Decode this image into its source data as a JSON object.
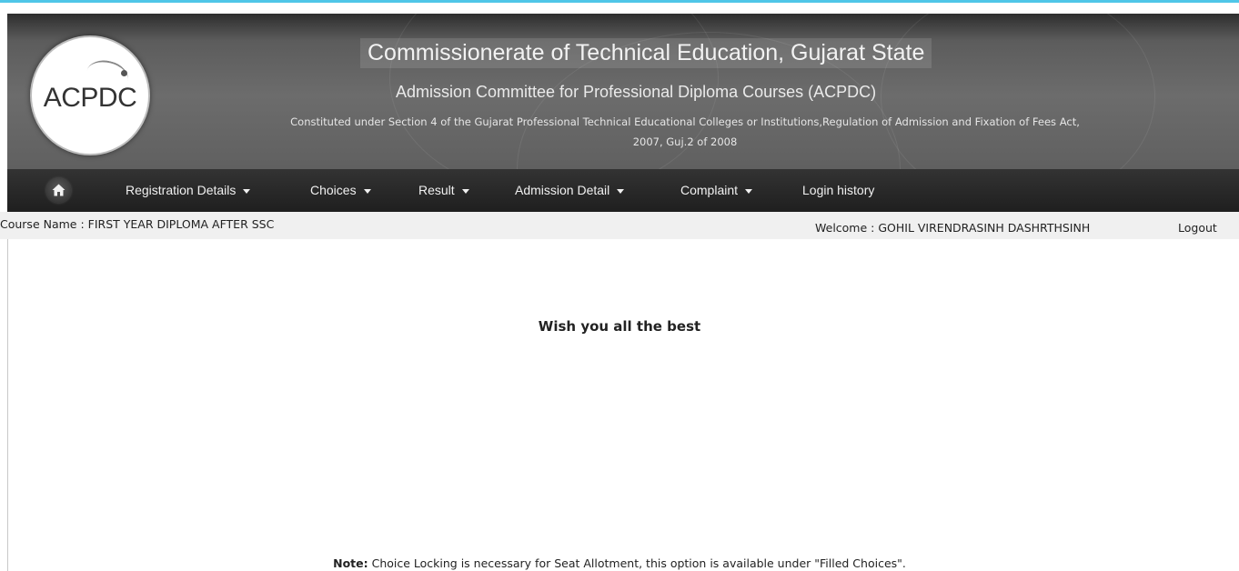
{
  "header": {
    "logo_text": "ACPDC",
    "title": "Commissionerate of Technical Education, Gujarat State",
    "subtitle": "Admission Committee for Professional Diploma Courses (ACPDC)",
    "constituted_line1": "Constituted under Section 4 of the Gujarat Professional Technical Educational Colleges or Institutions,Regulation of Admission and Fixation of Fees Act,",
    "constituted_line2": "2007, Guj.2 of 2008"
  },
  "nav": {
    "home_icon": "home-icon",
    "items": [
      {
        "label": "Registration Details",
        "has_dropdown": true
      },
      {
        "label": "Choices",
        "has_dropdown": true
      },
      {
        "label": "Result",
        "has_dropdown": true
      },
      {
        "label": "Admission Detail",
        "has_dropdown": true
      },
      {
        "label": "Complaint",
        "has_dropdown": true
      },
      {
        "label": "Login history",
        "has_dropdown": false
      }
    ]
  },
  "info_bar": {
    "course_name": "Course Name : FIRST YEAR DIPLOMA AFTER SSC",
    "welcome": "Welcome : GOHIL VIRENDRASINH DASHRTHSINH",
    "logout": "Logout"
  },
  "main": {
    "message": "Wish you all the best",
    "note_label": "Note:",
    "note_text": " Choice Locking is necessary for Seat Allotment, this option is available under \"Filled Choices\"."
  },
  "colors": {
    "accent_strip": "#4fc6e8",
    "nav_bg": "#1f1f1f",
    "info_bar_bg": "#f0f0f0"
  }
}
